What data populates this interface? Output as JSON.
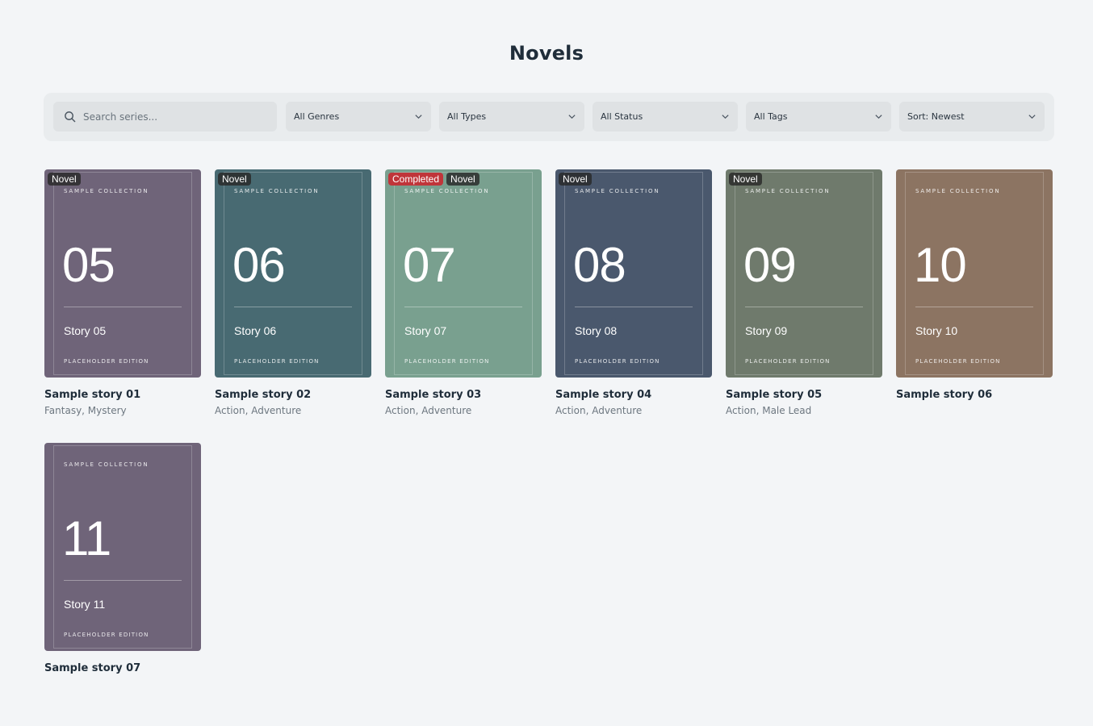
{
  "page": {
    "title": "Novels"
  },
  "filters": {
    "search_placeholder": "Search series...",
    "genres": "All Genres",
    "types": "All Types",
    "status": "All Status",
    "tags": "All Tags",
    "sort": "Sort: Newest"
  },
  "cover_common": {
    "collection": "SAMPLE COLLECTION",
    "edition": "PLACEHOLDER EDITION"
  },
  "cards": [
    {
      "number": "05",
      "story": "Story 05",
      "title": "Sample story 01",
      "genres": "Fantasy, Mystery",
      "color": "#6f6479",
      "badges": [
        "Novel"
      ],
      "completed": ""
    },
    {
      "number": "06",
      "story": "Story 06",
      "title": "Sample story 02",
      "genres": "Action, Adventure",
      "color": "#486a72",
      "badges": [
        "Novel"
      ],
      "completed": ""
    },
    {
      "number": "07",
      "story": "Story 07",
      "title": "Sample story 03",
      "genres": "Action, Adventure",
      "color": "#79a08f",
      "badges": [
        "Novel"
      ],
      "completed": "Completed"
    },
    {
      "number": "08",
      "story": "Story 08",
      "title": "Sample story 04",
      "genres": "Action, Adventure",
      "color": "#4a586d",
      "badges": [
        "Novel"
      ],
      "completed": ""
    },
    {
      "number": "09",
      "story": "Story 09",
      "title": "Sample story 05",
      "genres": "Action, Male Lead",
      "color": "#6f7a6c",
      "badges": [
        "Novel"
      ],
      "completed": ""
    },
    {
      "number": "10",
      "story": "Story 10",
      "title": "Sample story 06",
      "genres": "",
      "color": "#8c7462",
      "badges": [],
      "completed": ""
    },
    {
      "number": "11",
      "story": "Story 11",
      "title": "Sample story 07",
      "genres": "",
      "color": "#6f6479",
      "badges": [],
      "completed": ""
    }
  ]
}
